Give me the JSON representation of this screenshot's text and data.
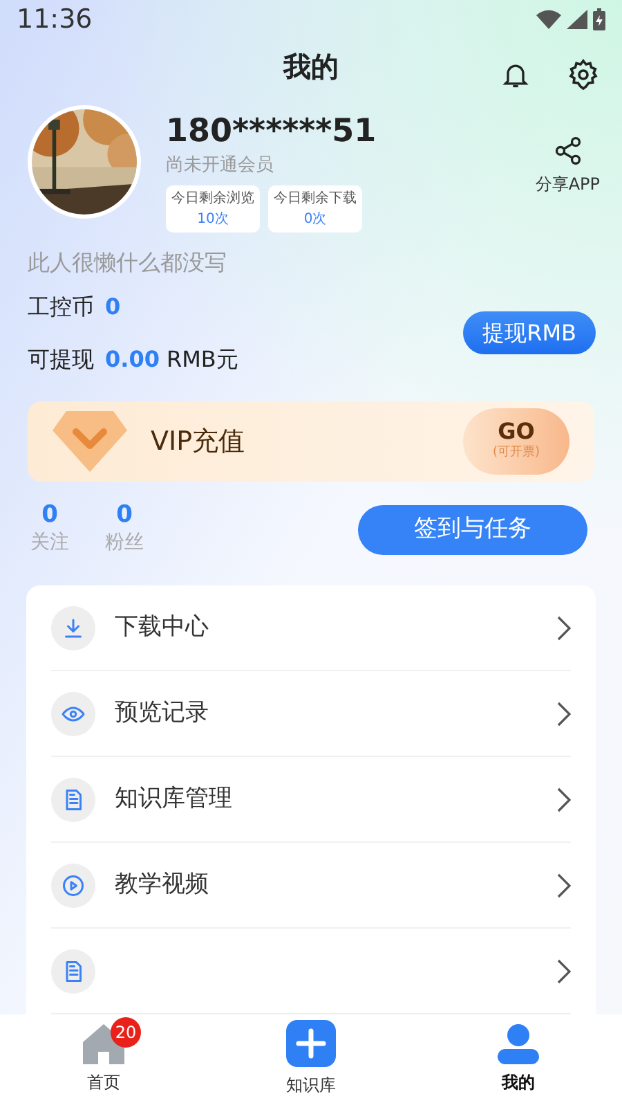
{
  "status_bar": {
    "time": "11:36"
  },
  "header": {
    "title": "我的"
  },
  "profile": {
    "name": "180******51",
    "membership": "尚未开通会员",
    "quotas": [
      {
        "label": "今日剩余浏览",
        "value": "10次"
      },
      {
        "label": "今日剩余下载",
        "value": "0次"
      }
    ],
    "share": "分享APP",
    "bio": "此人很懒什么都没写"
  },
  "wallet": {
    "coins_label": "工控币",
    "coins": "0",
    "withdraw_label": "可提现",
    "withdraw_amount": "0.00",
    "withdraw_unit": "RMB元",
    "withdraw_button": "提现RMB"
  },
  "vip": {
    "label": "VIP充值",
    "go": "GO",
    "note": "(可开票)"
  },
  "stats": [
    {
      "value": "0",
      "label": "关注"
    },
    {
      "value": "0",
      "label": "粉丝"
    }
  ],
  "tasks_button": "签到与任务",
  "menu": [
    {
      "kind": "download",
      "label": "下载中心"
    },
    {
      "kind": "eye",
      "label": "预览记录"
    },
    {
      "kind": "document",
      "label": "知识库管理"
    },
    {
      "kind": "play",
      "label": "教学视频"
    },
    {
      "kind": "document"
    }
  ],
  "nav": [
    {
      "kind": "home",
      "label": "首页",
      "badge": "20",
      "selected": false
    },
    {
      "kind": "plus",
      "label": "知识库",
      "selected": false
    },
    {
      "kind": "person",
      "label": "我的",
      "selected": true
    }
  ]
}
